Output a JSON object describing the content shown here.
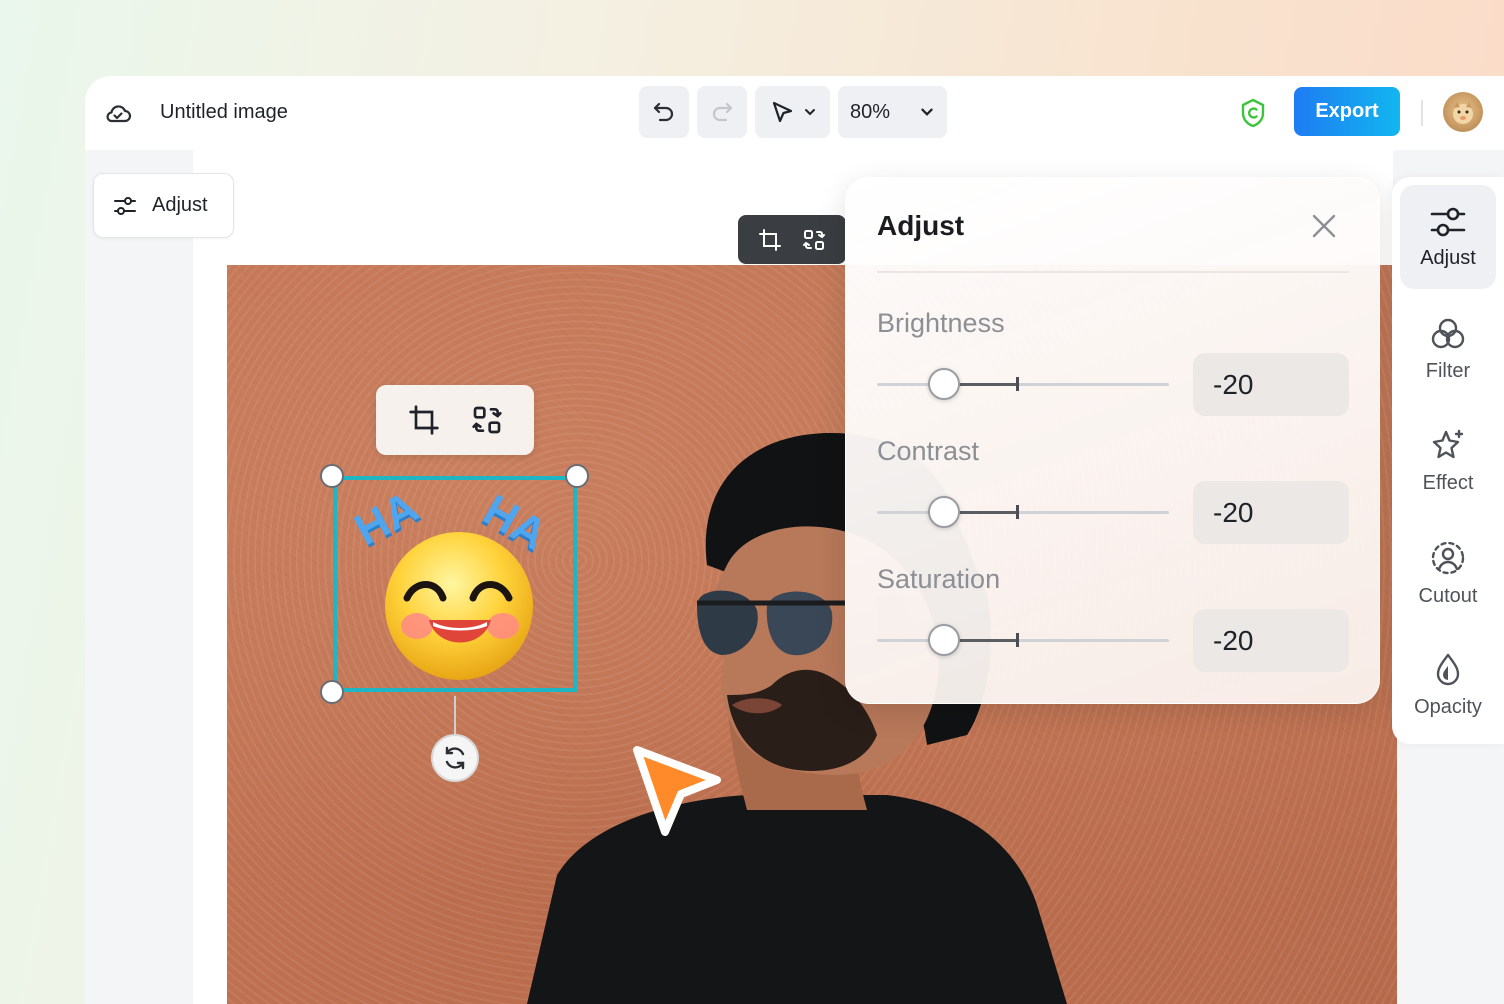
{
  "header": {
    "title": "Untitled image",
    "zoom": "80%",
    "export_label": "Export"
  },
  "left_chip": {
    "label": "Adjust"
  },
  "adjust_panel": {
    "title": "Adjust",
    "controls": [
      {
        "label": "Brightness",
        "value": "-20",
        "position": 0.23
      },
      {
        "label": "Contrast",
        "value": "-20",
        "position": 0.23
      },
      {
        "label": "Saturation",
        "value": "-20",
        "position": 0.23
      }
    ]
  },
  "sticker": {
    "text_left": "HA",
    "text_right": "HA"
  },
  "right_rail": {
    "items": [
      {
        "label": "Adjust",
        "icon": "sliders-icon",
        "active": true
      },
      {
        "label": "Filter",
        "icon": "filter-circles-icon",
        "active": false
      },
      {
        "label": "Effect",
        "icon": "sparkle-star-icon",
        "active": false
      },
      {
        "label": "Cutout",
        "icon": "cutout-person-icon",
        "active": false
      },
      {
        "label": "Opacity",
        "icon": "droplet-icon",
        "active": false
      }
    ]
  },
  "colors": {
    "accent_gradient_start": "#1e7cf2",
    "accent_gradient_end": "#12b6f0",
    "selection": "#1fb6c4",
    "cursor": "#ff8a2a",
    "shield": "#3cc43c"
  }
}
